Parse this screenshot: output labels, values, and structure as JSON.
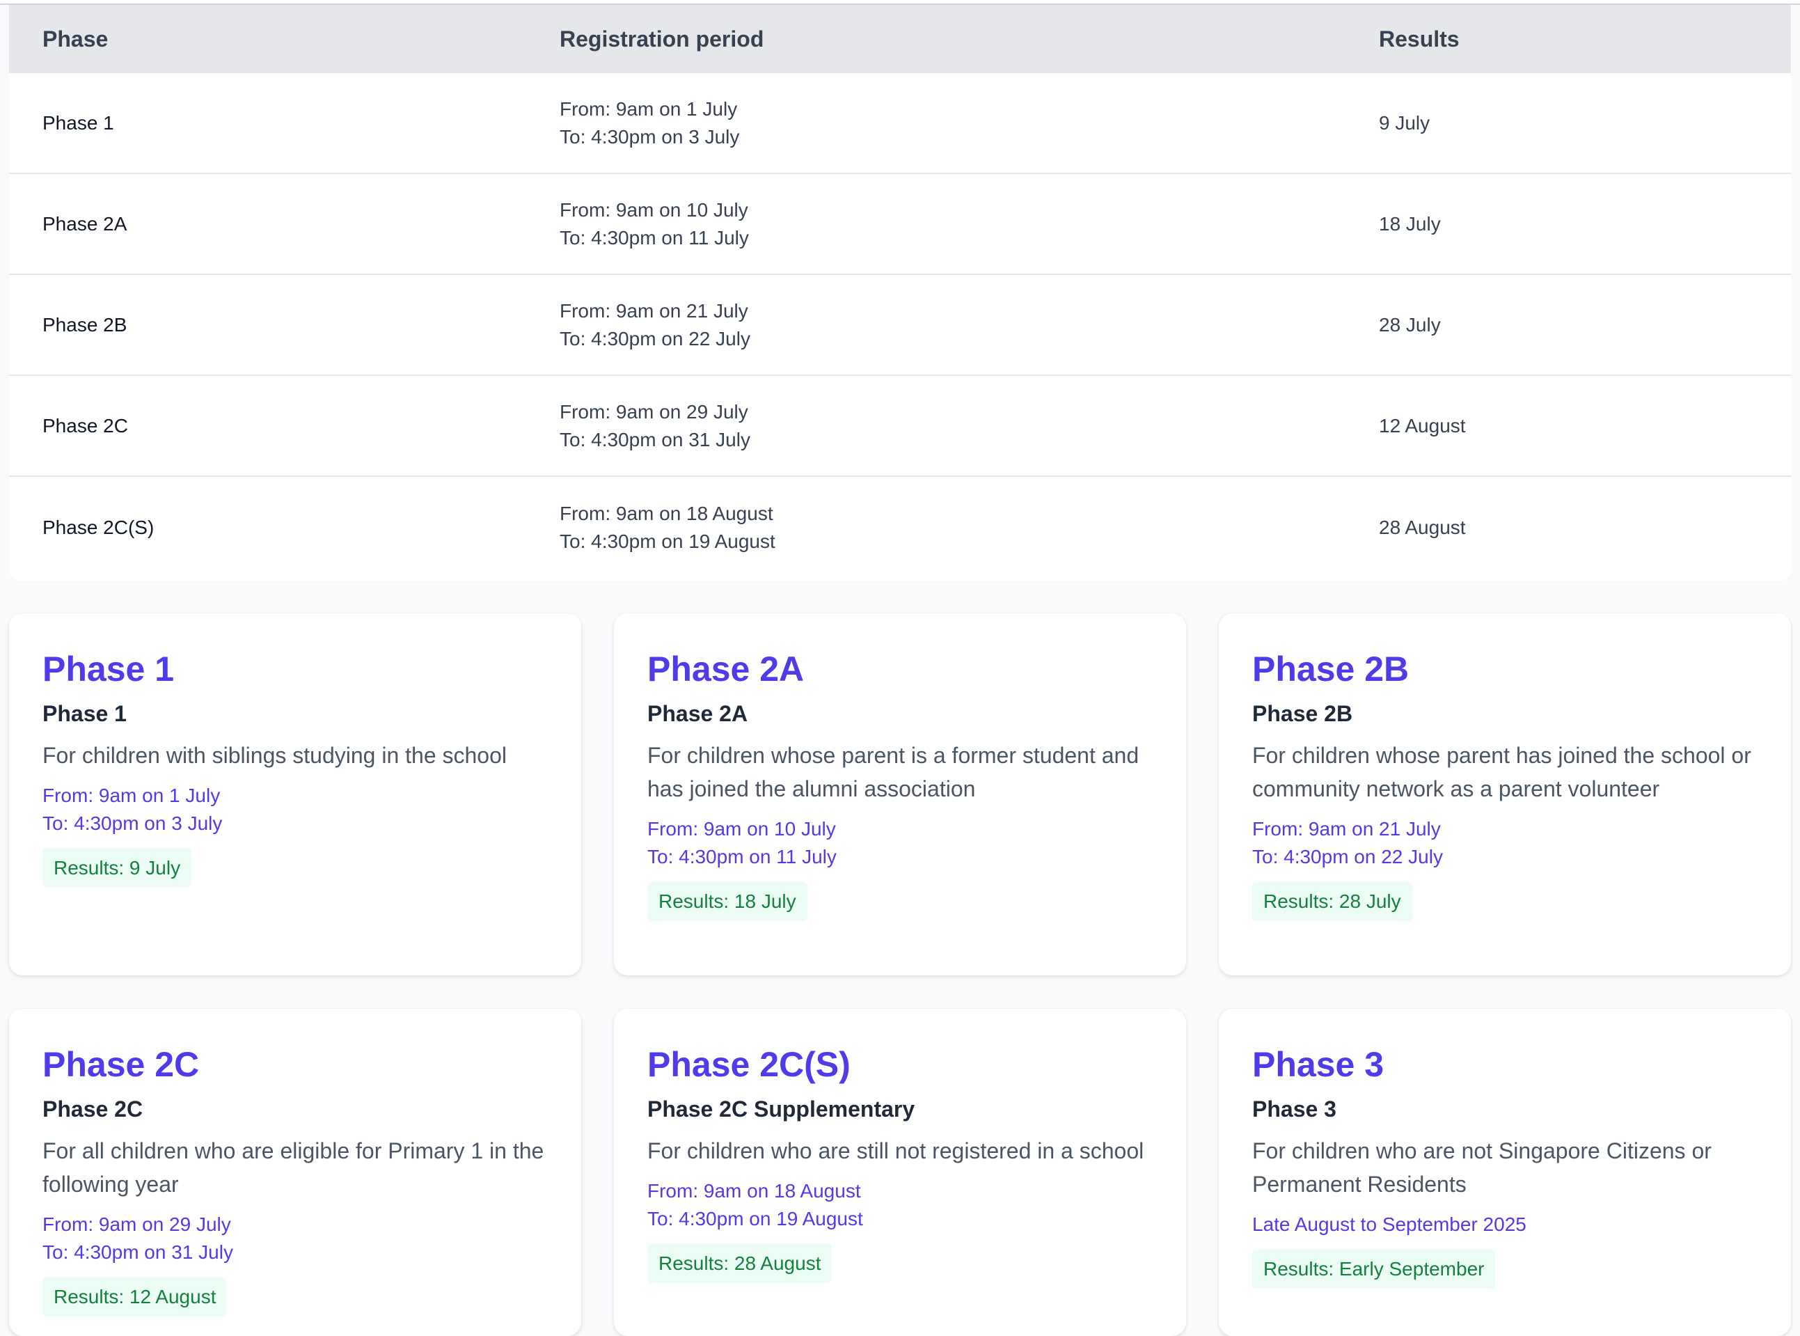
{
  "table": {
    "headers": {
      "phase": "Phase",
      "period": "Registration period",
      "results": "Results"
    },
    "rows": [
      {
        "phase": "Phase 1",
        "from": "From: 9am on 1 July",
        "to": "To: 4:30pm on 3 July",
        "results": "9 July"
      },
      {
        "phase": "Phase 2A",
        "from": "From: 9am on 10 July",
        "to": "To: 4:30pm on 11 July",
        "results": "18 July"
      },
      {
        "phase": "Phase 2B",
        "from": "From: 9am on 21 July",
        "to": "To: 4:30pm on 22 July",
        "results": "28 July"
      },
      {
        "phase": "Phase 2C",
        "from": "From: 9am on 29 July",
        "to": "To: 4:30pm on 31 July",
        "results": "12 August"
      },
      {
        "phase": "Phase 2C(S)",
        "from": "From: 9am on 18 August",
        "to": "To: 4:30pm on 19 August",
        "results": "28 August"
      }
    ]
  },
  "cards": [
    {
      "title": "Phase 1",
      "subtitle": "Phase 1",
      "description": "For children with siblings studying in the school",
      "from": "From: 9am on 1 July",
      "to": "To: 4:30pm on 3 July",
      "results": "Results: 9 July"
    },
    {
      "title": "Phase 2A",
      "subtitle": "Phase 2A",
      "description": "For children whose parent is a former student and has joined the alumni association",
      "from": "From: 9am on 10 July",
      "to": "To: 4:30pm on 11 July",
      "results": "Results: 18 July"
    },
    {
      "title": "Phase 2B",
      "subtitle": "Phase 2B",
      "description": "For children whose parent has joined the school or community network as a parent volunteer",
      "from": "From: 9am on 21 July",
      "to": "To: 4:30pm on 22 July",
      "results": "Results: 28 July"
    },
    {
      "title": "Phase 2C",
      "subtitle": "Phase 2C",
      "description": "For all children who are eligible for Primary 1 in the following year",
      "from": "From: 9am on 29 July",
      "to": "To: 4:30pm on 31 July",
      "results": "Results: 12 August"
    },
    {
      "title": "Phase 2C(S)",
      "subtitle": "Phase 2C Supplementary",
      "description": "For children who are still not registered in a school",
      "from": "From: 9am on 18 August",
      "to": "To: 4:30pm on 19 August",
      "results": "Results: 28 August"
    },
    {
      "title": "Phase 3",
      "subtitle": "Phase 3",
      "description": "For children who are not Singapore Citizens or Permanent Residents",
      "from": "Late August to September 2025",
      "to": "",
      "results": "Results: Early September"
    }
  ],
  "colors": {
    "accent": "#4f3bea",
    "results_text": "#15803d",
    "results_bg": "#ecfdf5",
    "header_bg": "#e5e7eb"
  }
}
